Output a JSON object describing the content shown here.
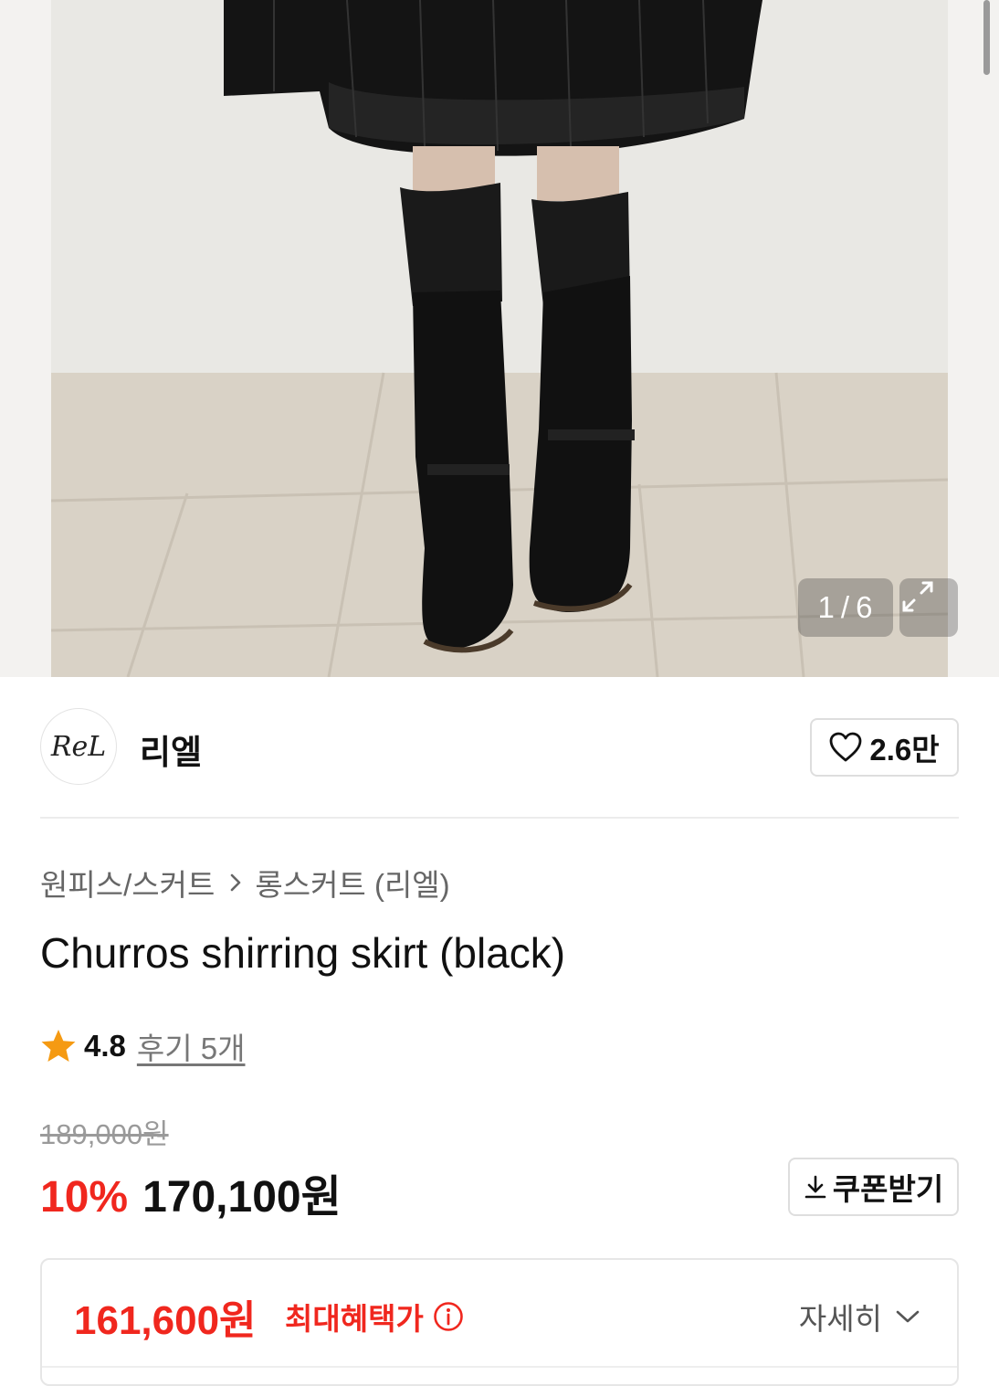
{
  "gallery": {
    "current_index": "1",
    "separator": "/",
    "total": "6",
    "expand_icon": "expand-arrows-icon"
  },
  "brand": {
    "logo_text": "ReL",
    "name": "리엘",
    "like_count": "2.6만",
    "like_icon": "heart-outline-icon"
  },
  "breadcrumb": {
    "category": "원피스/스커트",
    "subcategory": "롱스커트 (리엘)"
  },
  "product": {
    "title": "Churros shirring skirt (black)"
  },
  "rating": {
    "score": "4.8",
    "reviews_label": "후기 5개"
  },
  "price": {
    "original": "189,000원",
    "discount": "10%",
    "sale": "170,100원",
    "coupon_label": "쿠폰받기"
  },
  "benefit": {
    "max_price": "161,600원",
    "label": "최대혜택가",
    "detail_label": "자세히"
  },
  "colors": {
    "accent_red": "#f0271e",
    "text_primary": "#111111",
    "text_secondary": "#666666",
    "border": "#dedede"
  }
}
